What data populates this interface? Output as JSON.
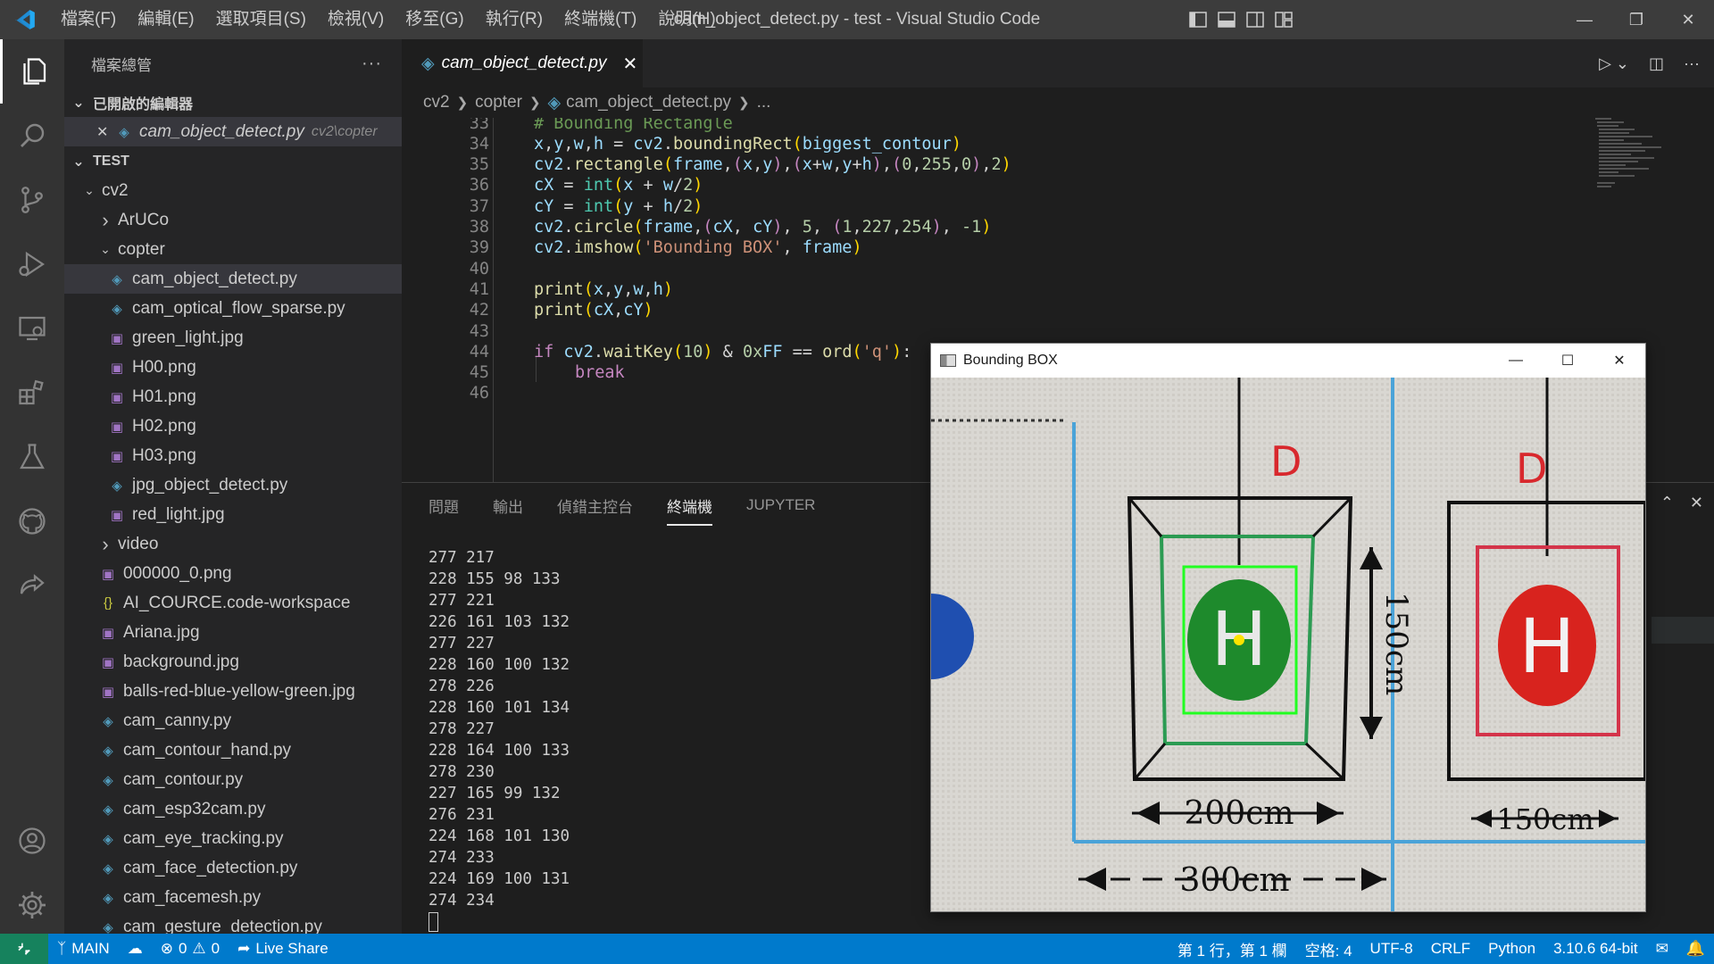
{
  "window": {
    "title": "cam_object_detect.py - test - Visual Studio Code"
  },
  "menu": [
    "檔案(F)",
    "編輯(E)",
    "選取項目(S)",
    "檢視(V)",
    "移至(G)",
    "執行(R)",
    "終端機(T)",
    "說明(H)"
  ],
  "sidebar": {
    "title": "檔案總管",
    "open_editors": {
      "label": "已開啟的編輯器",
      "items": [
        {
          "name": "cam_object_detect.py",
          "path": "cv2\\copter"
        }
      ]
    },
    "workspace_label": "TEST",
    "tree": [
      {
        "label": "cv2",
        "kind": "folder-open",
        "depth": 1
      },
      {
        "label": "ArUCo",
        "kind": "folder",
        "depth": 2
      },
      {
        "label": "copter",
        "kind": "folder-open",
        "depth": 2
      },
      {
        "label": "cam_object_detect.py",
        "kind": "py",
        "depth": 3,
        "selected": true
      },
      {
        "label": "cam_optical_flow_sparse.py",
        "kind": "py",
        "depth": 3
      },
      {
        "label": "green_light.jpg",
        "kind": "img",
        "depth": 3
      },
      {
        "label": "H00.png",
        "kind": "img",
        "depth": 3
      },
      {
        "label": "H01.png",
        "kind": "img",
        "depth": 3
      },
      {
        "label": "H02.png",
        "kind": "img",
        "depth": 3
      },
      {
        "label": "H03.png",
        "kind": "img",
        "depth": 3
      },
      {
        "label": "jpg_object_detect.py",
        "kind": "py",
        "depth": 3
      },
      {
        "label": "red_light.jpg",
        "kind": "img",
        "depth": 3
      },
      {
        "label": "video",
        "kind": "folder",
        "depth": 2
      },
      {
        "label": "000000_0.png",
        "kind": "img",
        "depth": 2
      },
      {
        "label": "AI_COURCE.code-workspace",
        "kind": "json",
        "depth": 2
      },
      {
        "label": "Ariana.jpg",
        "kind": "img",
        "depth": 2
      },
      {
        "label": "background.jpg",
        "kind": "img",
        "depth": 2
      },
      {
        "label": "balls-red-blue-yellow-green.jpg",
        "kind": "img",
        "depth": 2
      },
      {
        "label": "cam_canny.py",
        "kind": "py",
        "depth": 2
      },
      {
        "label": "cam_contour_hand.py",
        "kind": "py",
        "depth": 2
      },
      {
        "label": "cam_contour.py",
        "kind": "py",
        "depth": 2
      },
      {
        "label": "cam_esp32cam.py",
        "kind": "py",
        "depth": 2
      },
      {
        "label": "cam_eye_tracking.py",
        "kind": "py",
        "depth": 2
      },
      {
        "label": "cam_face_detection.py",
        "kind": "py",
        "depth": 2
      },
      {
        "label": "cam_facemesh.py",
        "kind": "py",
        "depth": 2
      },
      {
        "label": "cam_gesture_detection.py",
        "kind": "py",
        "depth": 2
      }
    ]
  },
  "editor": {
    "tab": "cam_object_detect.py",
    "breadcrumb": [
      "cv2",
      "copter",
      "cam_object_detect.py",
      "..."
    ],
    "lines": [
      {
        "n": "33",
        "indent": 0,
        "tokens": [
          [
            "cm",
            "# Bounding Rectangle"
          ]
        ]
      },
      {
        "n": "34",
        "indent": 0,
        "tokens": [
          [
            "vr",
            "x"
          ],
          [
            "pl",
            ","
          ],
          [
            "vr",
            "y"
          ],
          [
            "pl",
            ","
          ],
          [
            "vr",
            "w"
          ],
          [
            "pl",
            ","
          ],
          [
            "vr",
            "h"
          ],
          [
            "pl",
            " = "
          ],
          [
            "vr",
            "cv2"
          ],
          [
            "pl",
            "."
          ],
          [
            "fn",
            "boundingRect"
          ],
          [
            "pn",
            "("
          ],
          [
            "vr",
            "biggest_contour"
          ],
          [
            "pn",
            ")"
          ]
        ]
      },
      {
        "n": "35",
        "indent": 0,
        "tokens": [
          [
            "vr",
            "cv2"
          ],
          [
            "pl",
            "."
          ],
          [
            "fn",
            "rectangle"
          ],
          [
            "pn",
            "("
          ],
          [
            "vr",
            "frame"
          ],
          [
            "pl",
            ","
          ],
          [
            "kw",
            "("
          ],
          [
            "vr",
            "x"
          ],
          [
            "pl",
            ","
          ],
          [
            "vr",
            "y"
          ],
          [
            "kw",
            ")"
          ],
          [
            "pl",
            ","
          ],
          [
            "kw",
            "("
          ],
          [
            "vr",
            "x"
          ],
          [
            "pl",
            "+"
          ],
          [
            "vr",
            "w"
          ],
          [
            "pl",
            ","
          ],
          [
            "vr",
            "y"
          ],
          [
            "pl",
            "+"
          ],
          [
            "vr",
            "h"
          ],
          [
            "kw",
            ")"
          ],
          [
            "pl",
            ","
          ],
          [
            "kw",
            "("
          ],
          [
            "nm",
            "0"
          ],
          [
            "pl",
            ","
          ],
          [
            "nm",
            "255"
          ],
          [
            "pl",
            ","
          ],
          [
            "nm",
            "0"
          ],
          [
            "kw",
            ")"
          ],
          [
            "pl",
            ","
          ],
          [
            "nm",
            "2"
          ],
          [
            "pn",
            ")"
          ]
        ]
      },
      {
        "n": "36",
        "indent": 0,
        "tokens": [
          [
            "vr",
            "cX"
          ],
          [
            "pl",
            " = "
          ],
          [
            "bi",
            "int"
          ],
          [
            "pn",
            "("
          ],
          [
            "vr",
            "x"
          ],
          [
            "pl",
            " + "
          ],
          [
            "vr",
            "w"
          ],
          [
            "pl",
            "/"
          ],
          [
            "nm",
            "2"
          ],
          [
            "pn",
            ")"
          ]
        ]
      },
      {
        "n": "37",
        "indent": 0,
        "tokens": [
          [
            "vr",
            "cY"
          ],
          [
            "pl",
            " = "
          ],
          [
            "bi",
            "int"
          ],
          [
            "pn",
            "("
          ],
          [
            "vr",
            "y"
          ],
          [
            "pl",
            " + "
          ],
          [
            "vr",
            "h"
          ],
          [
            "pl",
            "/"
          ],
          [
            "nm",
            "2"
          ],
          [
            "pn",
            ")"
          ]
        ]
      },
      {
        "n": "38",
        "indent": 0,
        "tokens": [
          [
            "vr",
            "cv2"
          ],
          [
            "pl",
            "."
          ],
          [
            "fn",
            "circle"
          ],
          [
            "pn",
            "("
          ],
          [
            "vr",
            "frame"
          ],
          [
            "pl",
            ","
          ],
          [
            "kw",
            "("
          ],
          [
            "vr",
            "cX"
          ],
          [
            "pl",
            ", "
          ],
          [
            "vr",
            "cY"
          ],
          [
            "kw",
            ")"
          ],
          [
            "pl",
            ", "
          ],
          [
            "nm",
            "5"
          ],
          [
            "pl",
            ", "
          ],
          [
            "kw",
            "("
          ],
          [
            "nm",
            "1"
          ],
          [
            "pl",
            ","
          ],
          [
            "nm",
            "227"
          ],
          [
            "pl",
            ","
          ],
          [
            "nm",
            "254"
          ],
          [
            "kw",
            ")"
          ],
          [
            "pl",
            ", "
          ],
          [
            "nm",
            "-1"
          ],
          [
            "pn",
            ")"
          ]
        ]
      },
      {
        "n": "39",
        "indent": 0,
        "tokens": [
          [
            "vr",
            "cv2"
          ],
          [
            "pl",
            "."
          ],
          [
            "fn",
            "imshow"
          ],
          [
            "pn",
            "("
          ],
          [
            "st",
            "'Bounding BOX'"
          ],
          [
            "pl",
            ", "
          ],
          [
            "vr",
            "frame"
          ],
          [
            "pn",
            ")"
          ]
        ]
      },
      {
        "n": "40",
        "indent": 0,
        "tokens": []
      },
      {
        "n": "41",
        "indent": 0,
        "tokens": [
          [
            "fn",
            "print"
          ],
          [
            "pn",
            "("
          ],
          [
            "vr",
            "x"
          ],
          [
            "pl",
            ","
          ],
          [
            "vr",
            "y"
          ],
          [
            "pl",
            ","
          ],
          [
            "vr",
            "w"
          ],
          [
            "pl",
            ","
          ],
          [
            "vr",
            "h"
          ],
          [
            "pn",
            ")"
          ]
        ]
      },
      {
        "n": "42",
        "indent": 0,
        "tokens": [
          [
            "fn",
            "print"
          ],
          [
            "pn",
            "("
          ],
          [
            "vr",
            "cX"
          ],
          [
            "pl",
            ","
          ],
          [
            "vr",
            "cY"
          ],
          [
            "pn",
            ")"
          ]
        ]
      },
      {
        "n": "43",
        "indent": 0,
        "tokens": []
      },
      {
        "n": "44",
        "indent": 0,
        "tokens": [
          [
            "kw",
            "if "
          ],
          [
            "vr",
            "cv2"
          ],
          [
            "pl",
            "."
          ],
          [
            "fn",
            "waitKey"
          ],
          [
            "pn",
            "("
          ],
          [
            "nm",
            "10"
          ],
          [
            "pn",
            ")"
          ],
          [
            "pl",
            " & "
          ],
          [
            "nm",
            "0x"
          ],
          [
            "vr",
            "FF"
          ],
          [
            "pl",
            " == "
          ],
          [
            "fn",
            "ord"
          ],
          [
            "pn",
            "("
          ],
          [
            "st",
            "'q'"
          ],
          [
            "pn",
            ")"
          ],
          [
            "pl",
            ":"
          ]
        ]
      },
      {
        "n": "45",
        "indent": 1,
        "tokens": [
          [
            "kw",
            "break"
          ]
        ]
      },
      {
        "n": "46",
        "indent": 0,
        "tokens": []
      }
    ]
  },
  "panel": {
    "tabs": [
      "問題",
      "輸出",
      "偵錯主控台",
      "終端機",
      "JUPYTER"
    ],
    "active_tab": "終端機",
    "terminal_lines": [
      "277 217",
      "228 155 98 133",
      "277 221",
      "226 161 103 132",
      "277 227",
      "228 160 100 132",
      "278 226",
      "228 160 101 134",
      "278 227",
      "228 164 100 133",
      "278 230",
      "227 165 99 132",
      "276 231",
      "224 168 101 130",
      "274 233",
      "224 169 100 131",
      "274 234"
    ]
  },
  "cv_window": {
    "title": "Bounding BOX",
    "image_labels": {
      "pad_letter": "H",
      "left_marker": "D",
      "right_marker": "D",
      "dim_height": "150cm",
      "dim_width_left": "200cm",
      "dim_width_right": "150cm",
      "dim_total": "300cm"
    }
  },
  "statusbar": {
    "branch": "MAIN",
    "errors": "0",
    "warnings": "0",
    "live_share": "Live Share",
    "position": "第 1 行，第 1 欄",
    "spaces": "空格: 4",
    "encoding": "UTF-8",
    "eol": "CRLF",
    "language": "Python",
    "interpreter": "3.10.6 64-bit"
  },
  "colors": {
    "statusbar": "#007acc",
    "activitybar": "#333333",
    "sidebar": "#252526",
    "editor": "#1e1e1e",
    "titlebar": "#3c3c3c"
  }
}
